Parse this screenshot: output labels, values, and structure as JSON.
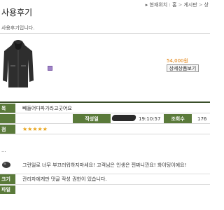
{
  "breadcrumb": {
    "location_label": "현재위치 :",
    "home": "홈",
    "board": "게시판",
    "current": "상"
  },
  "page": {
    "title": "사용후기",
    "description": "사용후기입니다."
  },
  "product": {
    "price": "54,000원",
    "detail_button": "상세상품보기"
  },
  "post": {
    "subject_label": "목",
    "subject": "빼들어다파가라고굿어요",
    "author_label": "작성일",
    "date": "19:10:57",
    "views_label": "조회수",
    "views": "176",
    "rating_label": "점",
    "rating_stars": "★★★★★",
    "body_dots": "..."
  },
  "comments": [
    {
      "text": "그런일로 너무 부끄러워하지마세요! 고객님은 인생은 찐짜니깐요! 화이팅이에요!"
    }
  ],
  "comment_form": {
    "label": "크기",
    "notice": "관리자에게만 댓글 작성 권한이 있습니다."
  },
  "attachment": {
    "label": "파일"
  },
  "colors": {
    "header_green": "#5a7a3a",
    "price_orange": "#e07a00",
    "star": "#e8a317"
  }
}
